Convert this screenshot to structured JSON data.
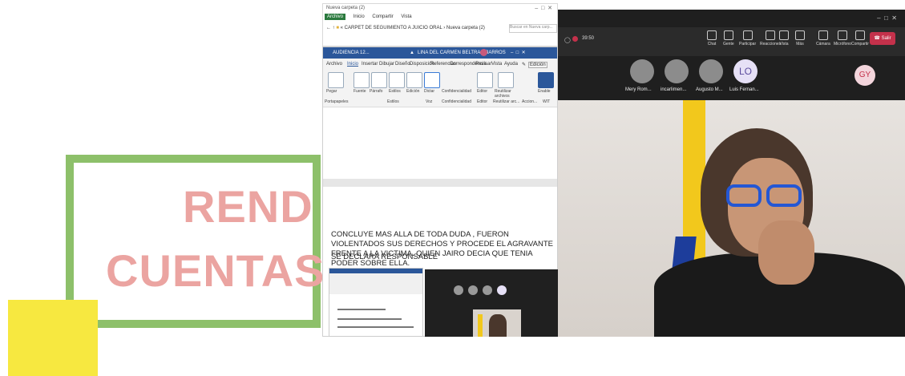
{
  "slide": {
    "title_line1": "REND",
    "title_line2": "CUENTAS",
    "colors": {
      "frame": "#8dc06a",
      "square": "#f7e840",
      "title": "#eba4a1"
    }
  },
  "explorer": {
    "title": "Nueva carpeta (2)",
    "tabs": [
      "Archivo",
      "Inicio",
      "Compartir",
      "Vista"
    ],
    "path": "« CARPET DE SEGUIMIENTO A JUICIO ORAL › Nueva carpeta (2)",
    "search_placeholder": "Buscar en Nueva carp..."
  },
  "word": {
    "title": "AUDIENCIA 12...",
    "user": "LINA DEL CARMEN BELTRAN BARROS",
    "menu": [
      "Archivo",
      "Inicio",
      "Insertar",
      "Dibujar",
      "Diseño",
      "Disposición",
      "Referencias",
      "Correspondencia",
      "Revisar",
      "Vista",
      "Ayuda"
    ],
    "editing_label": "Edición",
    "ribbon": {
      "paste": "Pegar",
      "font": "Fuente",
      "paragraph": "Párrafo",
      "styles": "Estilos",
      "editing": "Edición",
      "dictate": "Dictar",
      "confidentiality": "Confidencialidad",
      "editor": "Editor",
      "reuse": "Reutilizar archivos",
      "enable": "Enable",
      "group_clipboard": "Portapapeles",
      "group_styles": "Estilos",
      "group_voice": "Voz",
      "group_confidentiality": "Confidencialidad",
      "group_editor": "Editor",
      "group_reuse": "Reutilizar arc...",
      "group_actions": "Accion...",
      "group_wit": "WIT"
    },
    "paragraph1": "CONCLUYE MAS ALLA DE TODA DUDA , FUERON VIOLENTADOS SUS DERECHOS Y PROCEDE EL AGRAVANTE FRENTE A LA VICTIMA. QUIEN JAIRO DECIA QUE TENIA PODER SOBRE ELLA.",
    "paragraph2": "SE DECLARA RESPONSABLE"
  },
  "teams": {
    "timer": "39:50",
    "toolbar": [
      {
        "label": "Chat",
        "icon": "chat-icon"
      },
      {
        "label": "Gente",
        "icon": "people-icon"
      },
      {
        "label": "Participar",
        "icon": "hand-icon"
      },
      {
        "label": "Reacciones",
        "icon": "smile-icon"
      },
      {
        "label": "Vista",
        "icon": "view-icon"
      },
      {
        "label": "Más",
        "icon": "more-icon"
      },
      {
        "label": "Cámara",
        "icon": "camera-icon"
      },
      {
        "label": "Micrófono",
        "icon": "mic-icon"
      },
      {
        "label": "Compartir",
        "icon": "share-icon"
      }
    ],
    "leave_label": "Salir",
    "participants": [
      {
        "name": "Mery Rom...",
        "initials": ""
      },
      {
        "name": "incarlimen...",
        "initials": ""
      },
      {
        "name": "Augusto M...",
        "initials": ""
      },
      {
        "name": "Luis Fernan...",
        "initials": "LO"
      }
    ],
    "self_initials": "GY",
    "colors": {
      "leave": "#c4314b",
      "lo_avatar": "#e6e0f6",
      "gy_avatar": "#f3d5dc"
    }
  }
}
